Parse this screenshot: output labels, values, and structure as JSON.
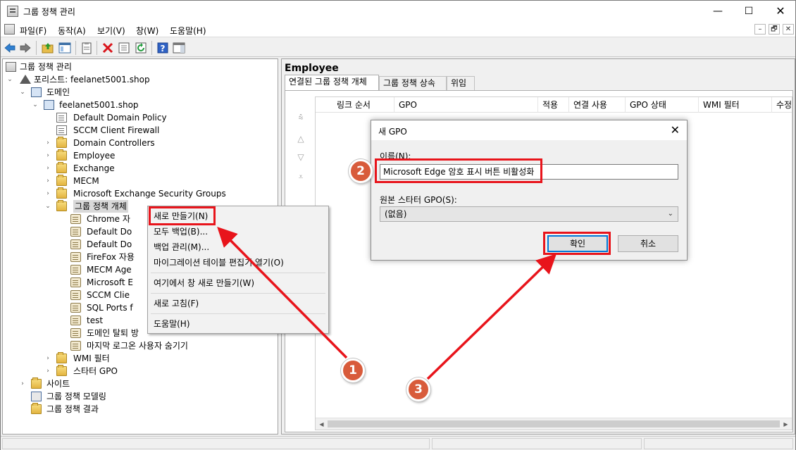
{
  "window": {
    "title": "그룹 정책 관리",
    "controls": {
      "minimize": "—",
      "maximize": "☐",
      "close": "✕"
    }
  },
  "menubar": {
    "items": [
      "파일(F)",
      "동작(A)",
      "보기(V)",
      "창(W)",
      "도움말(H)"
    ],
    "mdi_controls": [
      "–",
      "🗗",
      "✕"
    ]
  },
  "toolbar": {
    "icons": [
      "back-arrow-icon",
      "forward-arrow-icon",
      "up-folder-icon",
      "show-hide-tree-icon",
      "clipboard-icon",
      "delete-icon",
      "properties-icon",
      "refresh-icon",
      "help-icon",
      "action-pane-icon"
    ]
  },
  "tree": {
    "root": "그룹 정책 관리",
    "forest": "포리스트: feelanet5001.shop",
    "domains": "도메인",
    "domain": "feelanet5001.shop",
    "domain_children": [
      "Default Domain Policy",
      "SCCM Client Firewall",
      "Domain Controllers",
      "Employee",
      "Exchange",
      "MECM",
      "Microsoft Exchange Security Groups",
      "그룹 정책 개체"
    ],
    "gpo_children": [
      "Chrome 자",
      "Default Do",
      "Default Do",
      "FireFox 자용",
      "MECM Age",
      "Microsoft E",
      "SCCM Clie",
      "SQL Ports f",
      "test",
      "도메인 탈퇴 방",
      "마지막 로그온 사용자 숨기기"
    ],
    "after_gpo": [
      "WMI 필터",
      "스타터 GPO"
    ],
    "bottom": [
      "사이트",
      "그룹 정책 모델링",
      "그룹 정책 결과"
    ]
  },
  "right_pane": {
    "title": "Employee",
    "tabs": [
      "연결된 그룹 정책 개체",
      "그룹 정책 상속",
      "위임"
    ],
    "columns": [
      "링크 순서",
      "GPO",
      "적용",
      "연결 사용",
      "GPO 상태",
      "WMI 필터",
      "수정"
    ]
  },
  "context_menu": {
    "items": [
      "새로 만들기(N)",
      "모두 백업(B)...",
      "백업 관리(M)...",
      "마이그레이션 테이블 편집기 열기(O)",
      "여기에서 창 새로 만들기(W)",
      "새로 고침(F)",
      "도움말(H)"
    ]
  },
  "dialog": {
    "title": "새 GPO",
    "name_label": "이름(N):",
    "name_value": "Microsoft Edge 암호 표시 버튼 비활성화",
    "starter_label": "원본 스타터 GPO(S):",
    "starter_value": "(없음)",
    "ok_label": "확인",
    "cancel_label": "취소"
  },
  "annotations": {
    "badges": [
      "1",
      "2",
      "3"
    ],
    "highlight_color": "#e8141b",
    "badge_color": "#d85b3b"
  }
}
